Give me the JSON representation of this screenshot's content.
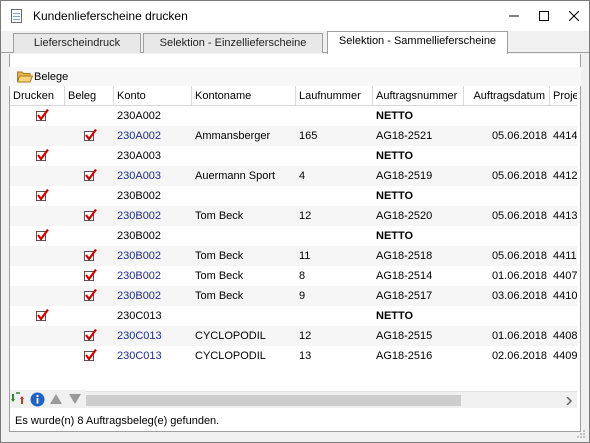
{
  "window": {
    "title": "Kundenlieferscheine drucken",
    "controls": [
      "minimize-icon",
      "maximize-icon",
      "close-icon"
    ]
  },
  "tabs": [
    {
      "label": "Lieferscheindruck",
      "active": false
    },
    {
      "label": "Selektion - Einzellieferscheine",
      "active": false
    },
    {
      "label": "Selektion - Sammellieferscheine",
      "active": true
    }
  ],
  "section": {
    "label": "Belege",
    "icon": "folder-open-icon"
  },
  "columns": [
    {
      "key": "drucken",
      "label": "Drucken"
    },
    {
      "key": "beleg",
      "label": "Beleg"
    },
    {
      "key": "konto",
      "label": "Konto"
    },
    {
      "key": "kontoname",
      "label": "Kontoname"
    },
    {
      "key": "laufnummer",
      "label": "Laufnummer"
    },
    {
      "key": "auftragsnummer",
      "label": "Auftragsnummer"
    },
    {
      "key": "auftragsdatum",
      "label": "Auftragsdatum"
    },
    {
      "key": "projekt",
      "label": "Proje"
    }
  ],
  "rows": [
    {
      "group": true,
      "drucken": true,
      "beleg": false,
      "konto": "230A002",
      "kontoname": "",
      "laufnummer": "",
      "auftragsnummer": "NETTO",
      "auftragsdatum": "",
      "projekt": ""
    },
    {
      "group": false,
      "drucken": false,
      "beleg": true,
      "konto": "230A002",
      "kontoname": "Ammansberger",
      "laufnummer": "165",
      "auftragsnummer": "AG18-2521",
      "auftragsdatum": "05.06.2018",
      "projekt": "4414"
    },
    {
      "group": true,
      "drucken": true,
      "beleg": false,
      "konto": "230A003",
      "kontoname": "",
      "laufnummer": "",
      "auftragsnummer": "NETTO",
      "auftragsdatum": "",
      "projekt": ""
    },
    {
      "group": false,
      "drucken": false,
      "beleg": true,
      "konto": "230A003",
      "kontoname": "Auermann Sport",
      "laufnummer": "4",
      "auftragsnummer": "AG18-2519",
      "auftragsdatum": "05.06.2018",
      "projekt": "4412"
    },
    {
      "group": true,
      "drucken": true,
      "beleg": false,
      "konto": "230B002",
      "kontoname": "",
      "laufnummer": "",
      "auftragsnummer": "NETTO",
      "auftragsdatum": "",
      "projekt": ""
    },
    {
      "group": false,
      "drucken": false,
      "beleg": true,
      "konto": "230B002",
      "kontoname": "Tom Beck",
      "laufnummer": "12",
      "auftragsnummer": "AG18-2520",
      "auftragsdatum": "05.06.2018",
      "projekt": "4413"
    },
    {
      "group": true,
      "drucken": true,
      "beleg": false,
      "konto": "230B002",
      "kontoname": "",
      "laufnummer": "",
      "auftragsnummer": "NETTO",
      "auftragsdatum": "",
      "projekt": ""
    },
    {
      "group": false,
      "drucken": false,
      "beleg": true,
      "konto": "230B002",
      "kontoname": "Tom Beck",
      "laufnummer": "11",
      "auftragsnummer": "AG18-2518",
      "auftragsdatum": "05.06.2018",
      "projekt": "4411"
    },
    {
      "group": false,
      "drucken": false,
      "beleg": true,
      "konto": "230B002",
      "kontoname": "Tom Beck",
      "laufnummer": "8",
      "auftragsnummer": "AG18-2514",
      "auftragsdatum": "01.06.2018",
      "projekt": "4407"
    },
    {
      "group": false,
      "drucken": false,
      "beleg": true,
      "konto": "230B002",
      "kontoname": "Tom Beck",
      "laufnummer": "9",
      "auftragsnummer": "AG18-2517",
      "auftragsdatum": "03.06.2018",
      "projekt": "4410"
    },
    {
      "group": true,
      "drucken": true,
      "beleg": false,
      "konto": "230C013",
      "kontoname": "",
      "laufnummer": "",
      "auftragsnummer": "NETTO",
      "auftragsdatum": "",
      "projekt": ""
    },
    {
      "group": false,
      "drucken": false,
      "beleg": true,
      "konto": "230C013",
      "kontoname": "CYCLOPODIL",
      "laufnummer": "12",
      "auftragsnummer": "AG18-2515",
      "auftragsdatum": "01.06.2018",
      "projekt": "4408"
    },
    {
      "group": false,
      "drucken": false,
      "beleg": true,
      "konto": "230C013",
      "kontoname": "CYCLOPODIL",
      "laufnummer": "13",
      "auftragsnummer": "AG18-2516",
      "auftragsdatum": "02.06.2018",
      "projekt": "4409"
    }
  ],
  "toolbar": [
    "refresh-icon",
    "info-icon",
    "move-up-icon",
    "move-down-icon"
  ],
  "status": "Es wurde(n) 8 Auftragsbeleg(e) gefunden.",
  "colors": {
    "link": "#1f2a8a",
    "check": "#d40000",
    "alt_row": "#f5f5f5"
  }
}
